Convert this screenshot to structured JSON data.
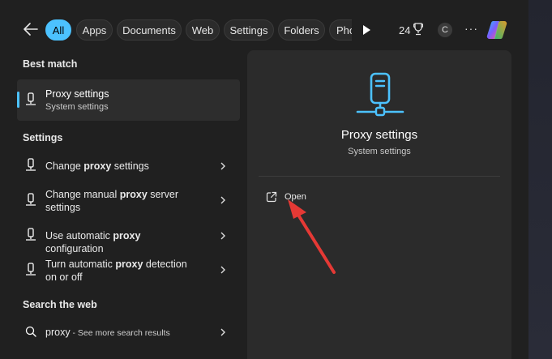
{
  "filters": {
    "tabs": [
      {
        "label": "All"
      },
      {
        "label": "Apps"
      },
      {
        "label": "Documents"
      },
      {
        "label": "Web"
      },
      {
        "label": "Settings"
      },
      {
        "label": "Folders"
      },
      {
        "label": "Pho"
      }
    ],
    "points": "24",
    "avatar_initial": "C",
    "more": "···"
  },
  "best_match": {
    "heading": "Best match",
    "title": "Proxy settings",
    "subtitle": "System settings"
  },
  "settings": {
    "heading": "Settings",
    "items": [
      {
        "pre": "Change ",
        "bold": "proxy",
        "post": " settings"
      },
      {
        "pre": "Change manual ",
        "bold": "proxy",
        "post": " server settings"
      },
      {
        "pre": "Use automatic ",
        "bold": "proxy",
        "post": " configuration"
      },
      {
        "pre": "Turn automatic ",
        "bold": "proxy",
        "post": " detection on or off"
      }
    ]
  },
  "web": {
    "heading": "Search the web",
    "query": "proxy",
    "suffix": " - See more search results"
  },
  "detail": {
    "title": "Proxy settings",
    "subtitle": "System settings",
    "open_label": "Open"
  },
  "colors": {
    "accent": "#4cc2ff",
    "annotation_arrow": "#e53935"
  }
}
